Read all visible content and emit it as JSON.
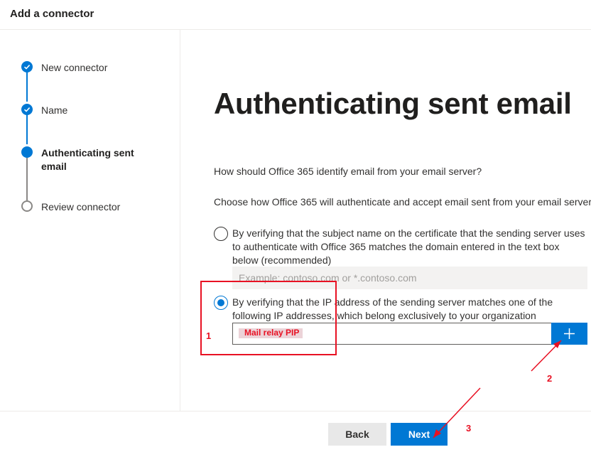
{
  "header": {
    "title": "Add a connector"
  },
  "steps": [
    {
      "label": "New connector",
      "state": "done"
    },
    {
      "label": "Name",
      "state": "done"
    },
    {
      "label": "Authenticating sent email",
      "state": "current"
    },
    {
      "label": "Review connector",
      "state": "todo"
    }
  ],
  "main": {
    "title": "Authenticating sent email",
    "question": "How should Office 365 identify email from your email server?",
    "instruction": "Choose how Office 365 will authenticate and accept email sent from your email server.",
    "option_cert": {
      "label": "By verifying that the subject name on the certificate that the sending server uses to authenticate with Office 365 matches the domain entered in the text box below (recommended)",
      "placeholder": "Example: contoso.com or *.contoso.com",
      "selected": false
    },
    "option_ip": {
      "label": "By verifying that the IP address of the sending server matches one of the following IP addresses, which belong exclusively to your organization",
      "value": "Mail relay PIP",
      "selected": true
    },
    "add_icon": "plus-icon"
  },
  "footer": {
    "back_label": "Back",
    "next_label": "Next"
  },
  "annotations": {
    "one": "1",
    "two": "2",
    "three": "3",
    "color": "#e81123"
  },
  "colors": {
    "accent": "#0078d4",
    "annotation": "#e81123"
  }
}
